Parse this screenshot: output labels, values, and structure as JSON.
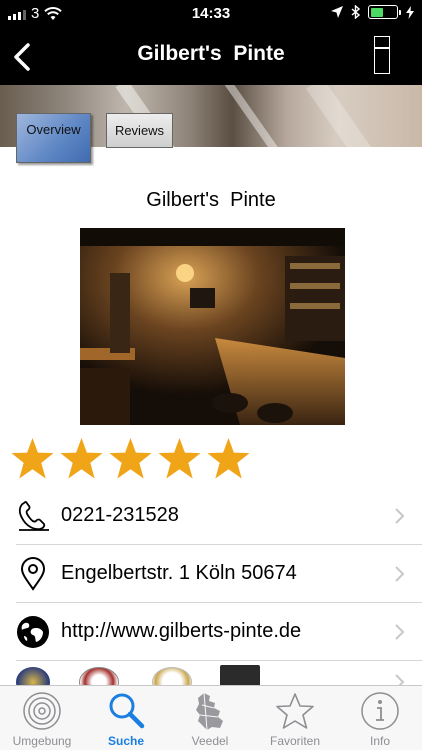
{
  "status_bar": {
    "carrier": "3",
    "time": "14:33"
  },
  "nav": {
    "title": "Gilbert's  Pinte"
  },
  "tabs": {
    "overview": "Overview",
    "reviews": "Reviews"
  },
  "place": {
    "name": "Gilbert's  Pinte",
    "rating_stars": 5,
    "rating_max": 5
  },
  "details": {
    "phone": "0221-231528",
    "address": "Engelbertstr. 1 Köln 50674",
    "website": "http://www.gilberts-pinte.de"
  },
  "tab_bar": {
    "items": [
      "Umgebung",
      "Suche",
      "Veedel",
      "Favoriten",
      "Info"
    ],
    "active": "Suche"
  },
  "colors": {
    "star": "#f0a417",
    "accent": "#1a7fe0",
    "inactive": "#8e8e93",
    "bar_bg": "#000000"
  }
}
